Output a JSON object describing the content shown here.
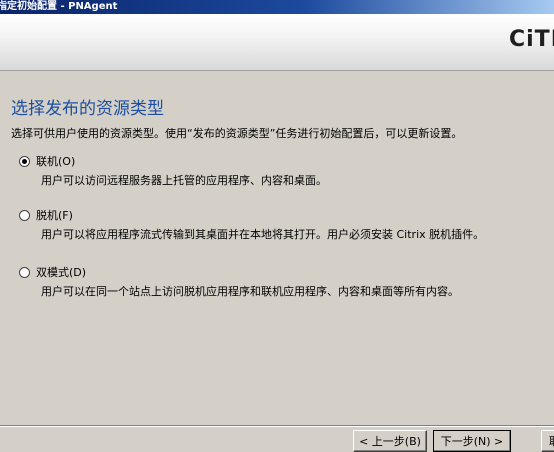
{
  "window": {
    "title": "指定初始配置 - PNAgent"
  },
  "banner": {
    "logo_text": "CiTR"
  },
  "page": {
    "heading": "选择发布的资源类型",
    "intro": "选择可供用户使用的资源类型。使用“发布的资源类型”任务进行初始配置后，可以更新设置。"
  },
  "options": [
    {
      "label": "联机(O)",
      "description": "用户可以访问远程服务器上托管的应用程序、内容和桌面。",
      "selected": true
    },
    {
      "label": "脱机(F)",
      "description": "用户可以将应用程序流式传输到其桌面并在本地将其打开。用户必须安装 Citrix 脱机插件。",
      "selected": false
    },
    {
      "label": "双模式(D)",
      "description": "用户可以在同一个站点上访问脱机应用程序和联机应用程序、内容和桌面等所有内容。",
      "selected": false
    }
  ],
  "buttons": {
    "back": "< 上一步(B)",
    "next": "下一步(N) >",
    "cancel": "取"
  },
  "colors": {
    "heading": "#1c4fa0",
    "title_bar": "#0a246a",
    "dialog_bg": "#d4d0c8"
  }
}
